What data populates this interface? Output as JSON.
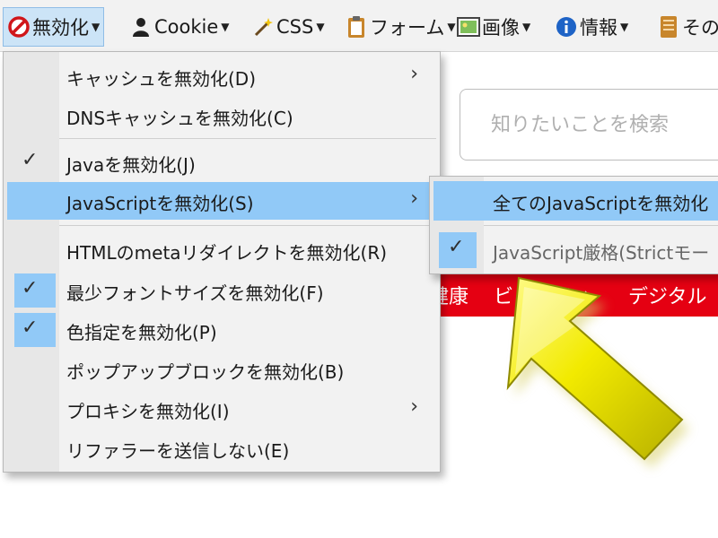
{
  "toolbar": {
    "disable": "無効化",
    "cookie": "Cookie",
    "css": "CSS",
    "form": "フォーム",
    "image": "画像",
    "info": "情報",
    "other": "その"
  },
  "search": {
    "placeholder": "知りたいことを検索"
  },
  "category_bar": {
    "items": [
      "健康",
      "ビューティ",
      "デジタル"
    ],
    "color": "#e50012"
  },
  "main_menu": {
    "items": [
      {
        "label": "キャッシュを無効化(D)",
        "checked": false,
        "submenu": true
      },
      {
        "label": "DNSキャッシュを無効化(C)",
        "checked": false,
        "submenu": false
      },
      {
        "label": "Javaを無効化(J)",
        "checked": true,
        "submenu": false
      },
      {
        "label": "JavaScriptを無効化(S)",
        "checked": false,
        "submenu": true,
        "highlighted": true
      },
      {
        "label": "HTMLのmetaリダイレクトを無効化(R)",
        "checked": false,
        "submenu": false
      },
      {
        "label": "最少フォントサイズを無効化(F)",
        "checked": true,
        "submenu": false
      },
      {
        "label": "色指定を無効化(P)",
        "checked": true,
        "submenu": false
      },
      {
        "label": "ポップアップブロックを無効化(B)",
        "checked": false,
        "submenu": false
      },
      {
        "label": "プロキシを無効化(I)",
        "checked": false,
        "submenu": true
      },
      {
        "label": "リファラーを送信しない(E)",
        "checked": false,
        "submenu": false
      }
    ],
    "check_glyph": "✓",
    "arrow_glyph": "›"
  },
  "sub_menu": {
    "items": [
      {
        "label": "全てのJavaScriptを無効化",
        "highlighted": true
      },
      {
        "label": "JavaScript厳格(Strictモー",
        "checked": true
      }
    ]
  },
  "colors": {
    "highlight": "#91c9f7",
    "menu_bg": "#f2f2f2",
    "arrow": "#f2ea00"
  }
}
